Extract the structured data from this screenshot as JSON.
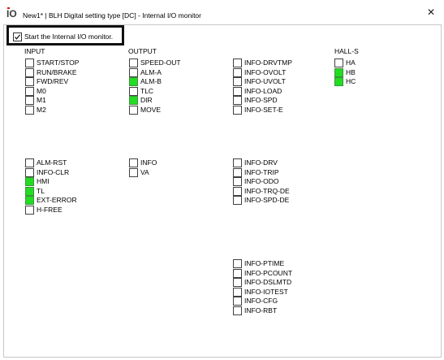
{
  "window": {
    "icon_letters": "IO",
    "title": "New1* | BLH Digital setting type [DC] - Internal I/O monitor",
    "close_glyph": "✕"
  },
  "monitor": {
    "label": "Start the Internal I/O monitor.",
    "checked": true
  },
  "headers": {
    "input": "INPUT",
    "output": "OUTPUT",
    "hall": "HALL-S"
  },
  "indicator_color_on": "#22dd22",
  "groups": {
    "input_1": [
      {
        "label": "START/STOP",
        "on": false
      },
      {
        "label": "RUN/BRAKE",
        "on": false
      },
      {
        "label": "FWD/REV",
        "on": false
      },
      {
        "label": "M0",
        "on": false
      },
      {
        "label": "M1",
        "on": false
      },
      {
        "label": "M2",
        "on": false
      }
    ],
    "output_1": [
      {
        "label": "SPEED-OUT",
        "on": false
      },
      {
        "label": "ALM-A",
        "on": false
      },
      {
        "label": "ALM-B",
        "on": true
      },
      {
        "label": "TLC",
        "on": false
      },
      {
        "label": "DIR",
        "on": true
      },
      {
        "label": "MOVE",
        "on": false
      }
    ],
    "info_1": [
      {
        "label": "INFO-DRVTMP",
        "on": false
      },
      {
        "label": "INFO-OVOLT",
        "on": false
      },
      {
        "label": "INFO-UVOLT",
        "on": false
      },
      {
        "label": "INFO-LOAD",
        "on": false
      },
      {
        "label": "INFO-SPD",
        "on": false
      },
      {
        "label": "INFO-SET-E",
        "on": false
      }
    ],
    "hall": [
      {
        "label": "HA",
        "on": false
      },
      {
        "label": "HB",
        "on": true
      },
      {
        "label": "HC",
        "on": true
      }
    ],
    "input_2": [
      {
        "label": "ALM-RST",
        "on": false
      },
      {
        "label": "INFO-CLR",
        "on": false
      },
      {
        "label": "HMI",
        "on": true
      },
      {
        "label": "TL",
        "on": true
      },
      {
        "label": "EXT-ERROR",
        "on": true
      },
      {
        "label": "H-FREE",
        "on": false
      }
    ],
    "output_2": [
      {
        "label": "INFO",
        "on": false
      },
      {
        "label": "VA",
        "on": false
      }
    ],
    "info_2": [
      {
        "label": "INFO-DRV",
        "on": false
      },
      {
        "label": "INFO-TRIP",
        "on": false
      },
      {
        "label": "INFO-ODO",
        "on": false
      },
      {
        "label": "INFO-TRQ-DE",
        "on": false
      },
      {
        "label": "INFO-SPD-DE",
        "on": false
      }
    ],
    "info_3": [
      {
        "label": "INFO-PTIME",
        "on": false
      },
      {
        "label": "INFO-PCOUNT",
        "on": false
      },
      {
        "label": "INFO-DSLMTD",
        "on": false
      },
      {
        "label": "INFO-IOTEST",
        "on": false
      },
      {
        "label": "INFO-CFG",
        "on": false
      },
      {
        "label": "INFO-RBT",
        "on": false
      }
    ]
  }
}
